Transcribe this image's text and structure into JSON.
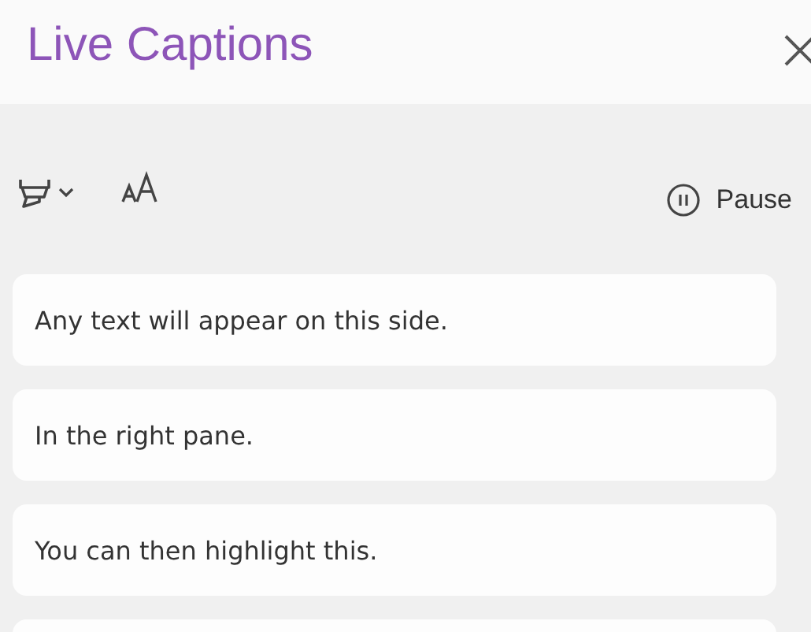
{
  "window": {
    "title": "Live Captions"
  },
  "toolbar": {
    "pause": {
      "label": "Pause"
    }
  },
  "captions": [
    {
      "text": "Any text will appear on this side."
    },
    {
      "text": "In the right pane."
    },
    {
      "text": "You can then highlight this."
    }
  ]
}
